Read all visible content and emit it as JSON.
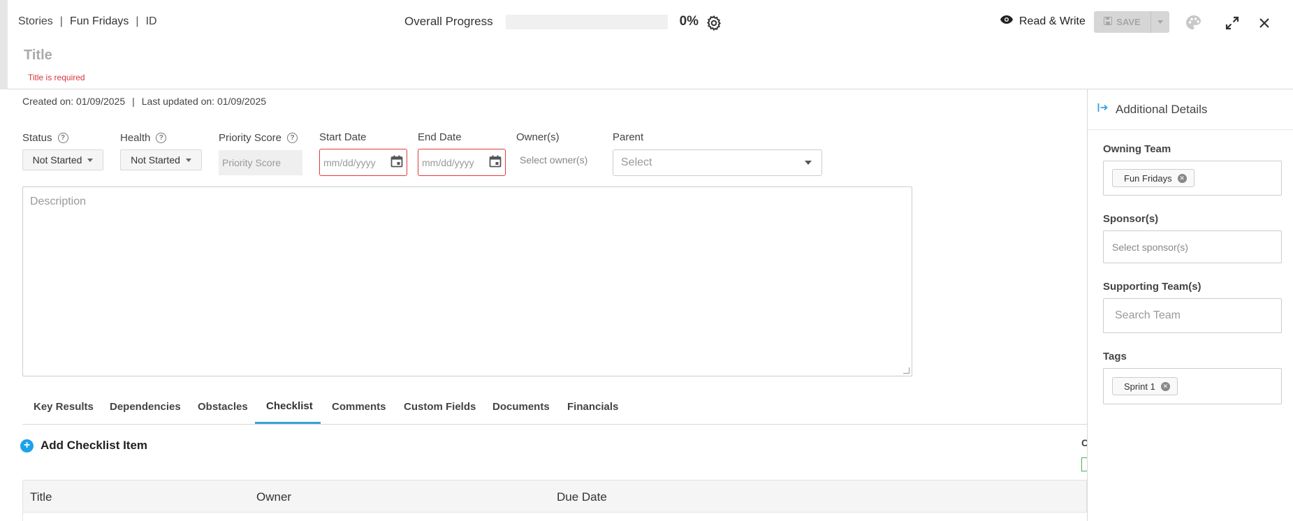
{
  "header": {
    "breadcrumb": [
      "Stories",
      "Fun Fridays",
      "ID"
    ],
    "progress_label": "Overall Progress",
    "progress_percent": "0%",
    "progress_value": 0,
    "read_write_label": "Read & Write",
    "save_label": "SAVE",
    "title_placeholder": "Title",
    "title_error": "Title is required"
  },
  "meta": {
    "created": "Created on: 01/09/2025",
    "separator": "|",
    "updated": "Last updated on: 01/09/2025"
  },
  "fields": {
    "status_label": "Status",
    "status_value": "Not Started",
    "health_label": "Health",
    "health_value": "Not Started",
    "priority_label": "Priority Score",
    "priority_placeholder": "Priority Score",
    "start_label": "Start Date",
    "start_placeholder": "mm/dd/yyyy",
    "end_label": "End Date",
    "end_placeholder": "mm/dd/yyyy",
    "owner_label": "Owner(s)",
    "owner_placeholder": "Select owner(s)",
    "parent_label": "Parent",
    "parent_placeholder": "Select",
    "description_placeholder": "Description"
  },
  "tabs": [
    {
      "label": "Key Results"
    },
    {
      "label": "Dependencies"
    },
    {
      "label": "Obstacles"
    },
    {
      "label": "Checklist",
      "active": true
    },
    {
      "label": "Comments"
    },
    {
      "label": "Custom Fields"
    },
    {
      "label": "Documents"
    },
    {
      "label": "Financials"
    }
  ],
  "checklist": {
    "add_label": "Add Checklist Item",
    "partial_label": "C",
    "columns": [
      "Title",
      "Owner",
      "Due Date"
    ]
  },
  "panel": {
    "title": "Additional Details",
    "owning_team_label": "Owning Team",
    "owning_team_chip": "Fun Fridays",
    "sponsors_label": "Sponsor(s)",
    "sponsors_placeholder": "Select sponsor(s)",
    "supporting_label": "Supporting Team(s)",
    "supporting_placeholder": "Search Team",
    "tags_label": "Tags",
    "tag_chip": "Sprint 1"
  },
  "colors": {
    "accent": "#3aa0db",
    "error": "#e23a3a",
    "save_disabled": "#d6d6d6"
  }
}
